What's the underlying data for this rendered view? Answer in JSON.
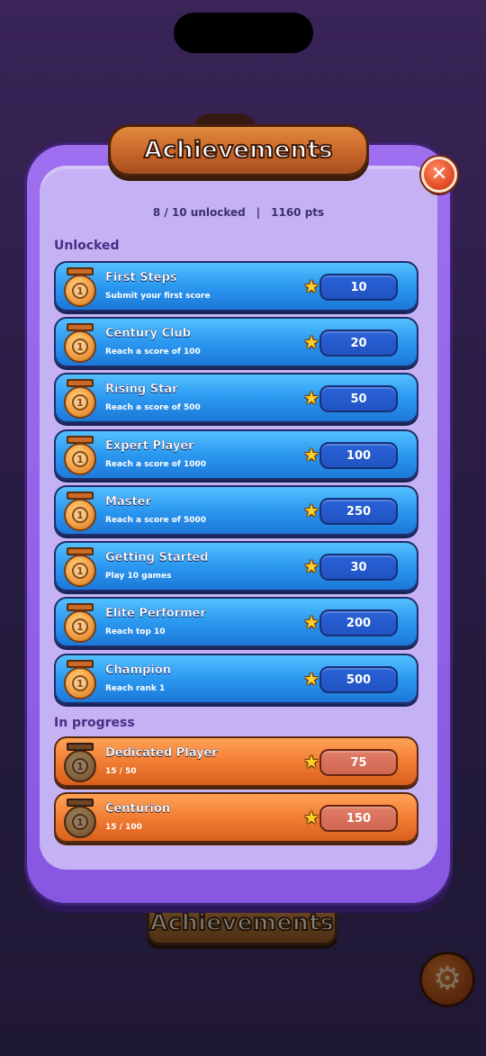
{
  "title": "Achievements",
  "summary": {
    "unlocked": "8 / 10 unlocked",
    "points": "1160 pts"
  },
  "sections": {
    "unlocked": "Unlocked",
    "in_progress": "In progress"
  },
  "unlocked": [
    {
      "name": "First Steps",
      "desc": "Submit your first score",
      "points": "10"
    },
    {
      "name": "Century Club",
      "desc": "Reach a score of 100",
      "points": "20"
    },
    {
      "name": "Rising Star",
      "desc": "Reach a score of 500",
      "points": "50"
    },
    {
      "name": "Expert Player",
      "desc": "Reach a score of 1000",
      "points": "100"
    },
    {
      "name": "Master",
      "desc": "Reach a score of 5000",
      "points": "250"
    },
    {
      "name": "Getting Started",
      "desc": "Play 10 games",
      "points": "30"
    },
    {
      "name": "Elite Performer",
      "desc": "Reach top 10",
      "points": "200"
    },
    {
      "name": "Champion",
      "desc": "Reach rank 1",
      "points": "500"
    }
  ],
  "in_progress": [
    {
      "name": "Dedicated Player",
      "desc": "15 / 50",
      "points": "75"
    },
    {
      "name": "Centurion",
      "desc": "15 / 100",
      "points": "150"
    }
  ],
  "background": {
    "title": "Achievements"
  },
  "icons": {
    "close": "close-icon",
    "medal": "medal-icon",
    "star": "star-icon",
    "gear": "gear-icon"
  },
  "colors": {
    "panel": "#8757e2",
    "panel_inner": "#c5b2f5",
    "unlocked_card": "#2b98f0",
    "progress_card": "#f07a30",
    "title_banner": "#c8652a"
  }
}
